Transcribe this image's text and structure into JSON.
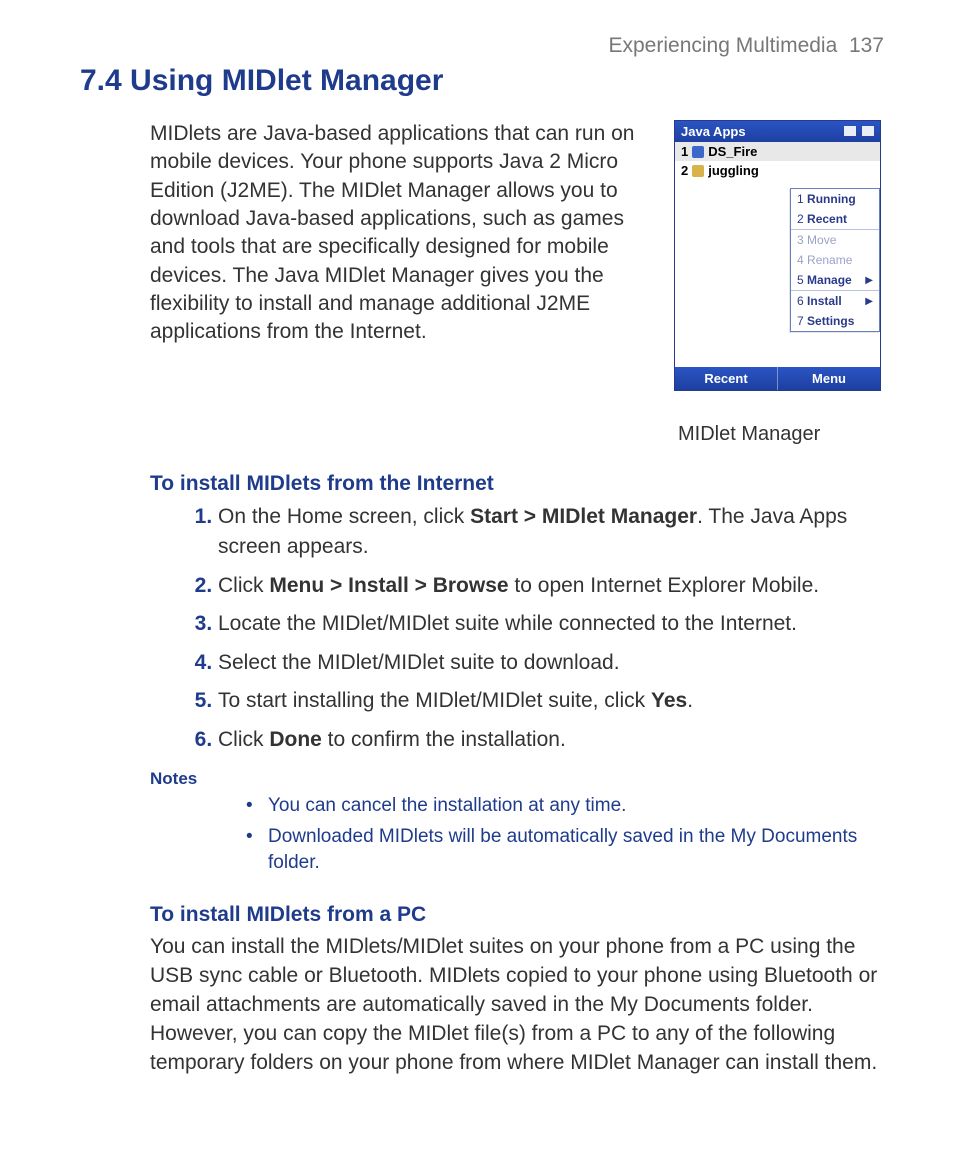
{
  "header": {
    "chapter": "Experiencing Multimedia",
    "page_number": "137"
  },
  "title": "7.4 Using MIDlet Manager",
  "intro": "MIDlets are Java-based applications that can run on mobile devices. Your phone supports Java 2 Micro Edition (J2ME). The MIDlet Manager allows you to download Java-based applications, such as games and tools that are specifically designed for mobile devices. The Java MIDlet Manager gives you the flexibility to install and manage additional J2ME applications from the Internet.",
  "figure": {
    "caption": "MIDlet Manager",
    "titlebar": "Java Apps",
    "apps": [
      {
        "num": "1",
        "name": "DS_Fire",
        "icon": "fire",
        "selected": true
      },
      {
        "num": "2",
        "name": "juggling",
        "icon": "key",
        "selected": false
      }
    ],
    "menu_items": [
      {
        "num": "1",
        "label": "Running",
        "disabled": false,
        "arrow": false
      },
      {
        "num": "2",
        "label": "Recent",
        "disabled": false,
        "arrow": false
      },
      {
        "sep": true
      },
      {
        "num": "3",
        "label": "Move",
        "disabled": true,
        "arrow": false
      },
      {
        "num": "4",
        "label": "Rename",
        "disabled": true,
        "arrow": false
      },
      {
        "num": "5",
        "label": "Manage",
        "disabled": false,
        "arrow": true
      },
      {
        "sep": true
      },
      {
        "num": "6",
        "label": "Install",
        "disabled": false,
        "arrow": true
      },
      {
        "num": "7",
        "label": "Settings",
        "disabled": false,
        "arrow": false
      }
    ],
    "softkeys": {
      "left": "Recent",
      "right": "Menu"
    }
  },
  "section_internet": {
    "heading": "To install MIDlets from the Internet",
    "steps": [
      {
        "pre": "On the Home screen, click ",
        "bold": "Start > MIDlet Manager",
        "post": ". The Java Apps screen appears."
      },
      {
        "pre": "Click ",
        "bold": "Menu > Install > Browse",
        "post": " to open Internet Explorer Mobile."
      },
      {
        "pre": "Locate the MIDlet/MIDlet suite while connected to the Internet.",
        "bold": "",
        "post": ""
      },
      {
        "pre": "Select the MIDlet/MIDlet suite to download.",
        "bold": "",
        "post": ""
      },
      {
        "pre": "To start installing the MIDlet/MIDlet suite, click ",
        "bold": "Yes",
        "post": "."
      },
      {
        "pre": "Click ",
        "bold": "Done",
        "post": " to confirm the installation."
      }
    ]
  },
  "notes": {
    "label": "Notes",
    "items": [
      "You can cancel the installation at any time.",
      "Downloaded MIDlets will be automatically saved in the My Documents folder."
    ]
  },
  "section_pc": {
    "heading": "To install MIDlets from a PC",
    "para": "You can install the MIDlets/MIDlet suites on your phone from a PC using the USB sync cable or Bluetooth. MIDlets copied to your phone using Bluetooth or email attachments are automatically saved in the My Documents folder. However, you can copy the MIDlet file(s) from a PC to any of the following temporary folders on your phone from where MIDlet Manager can install them."
  }
}
